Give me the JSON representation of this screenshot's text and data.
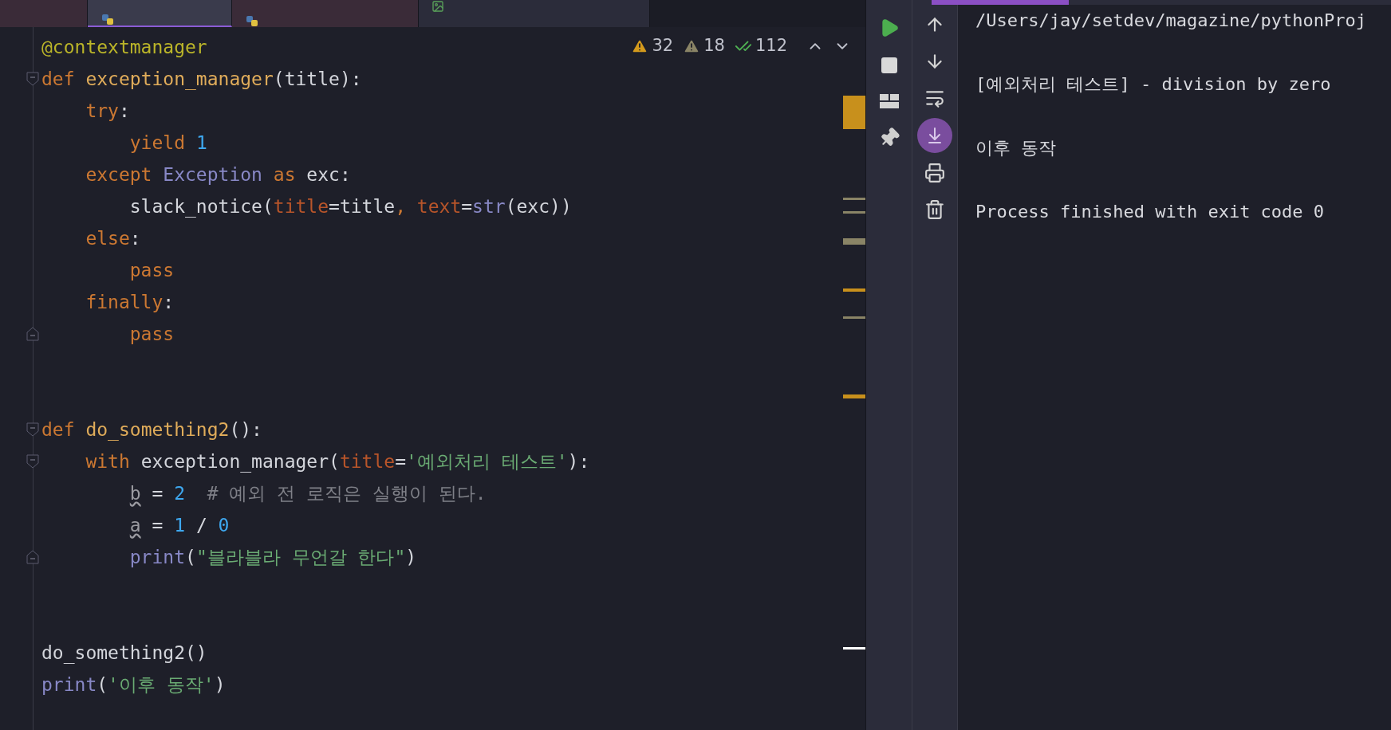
{
  "tabs": [
    {
      "kind": "none",
      "selected": false
    },
    {
      "kind": "python",
      "selected": true
    },
    {
      "kind": "python",
      "selected": false
    },
    {
      "kind": "image",
      "selected": false
    }
  ],
  "inspections": [
    {
      "kind": "warning",
      "count": "32"
    },
    {
      "kind": "weak_warning",
      "count": "18"
    },
    {
      "kind": "ok",
      "count": "112"
    }
  ],
  "code_lines": [
    {
      "kind": "code",
      "tokens": [
        {
          "kind": "decorator",
          "text": "@contextmanager"
        }
      ]
    },
    {
      "kind": "code",
      "fold_start": true,
      "tokens": [
        {
          "kind": "keyword",
          "text": "def "
        },
        {
          "kind": "function",
          "text": "exception_manager"
        },
        {
          "kind": "plain",
          "text": "(title):"
        }
      ]
    },
    {
      "kind": "code",
      "tokens": [
        {
          "kind": "keyword",
          "text": "    try"
        },
        {
          "kind": "plain",
          "text": ":"
        }
      ]
    },
    {
      "kind": "code",
      "tokens": [
        {
          "kind": "keyword",
          "text": "        yield "
        },
        {
          "kind": "number",
          "text": "1"
        }
      ]
    },
    {
      "kind": "code",
      "tokens": [
        {
          "kind": "keyword",
          "text": "    except "
        },
        {
          "kind": "builtin",
          "text": "Exception "
        },
        {
          "kind": "keyword",
          "text": "as "
        },
        {
          "kind": "plain",
          "text": "exc:"
        }
      ]
    },
    {
      "kind": "code",
      "tokens": [
        {
          "kind": "plain",
          "text": "        slack_notice("
        },
        {
          "kind": "param",
          "text": "title"
        },
        {
          "kind": "plain",
          "text": "=title"
        },
        {
          "kind": "keyword",
          "text": ", "
        },
        {
          "kind": "param",
          "text": "text"
        },
        {
          "kind": "plain",
          "text": "="
        },
        {
          "kind": "builtin",
          "text": "str"
        },
        {
          "kind": "plain",
          "text": "(exc))"
        }
      ]
    },
    {
      "kind": "code",
      "tokens": [
        {
          "kind": "keyword",
          "text": "    else"
        },
        {
          "kind": "plain",
          "text": ":"
        }
      ]
    },
    {
      "kind": "code",
      "tokens": [
        {
          "kind": "keyword",
          "text": "        pass"
        }
      ]
    },
    {
      "kind": "code",
      "tokens": [
        {
          "kind": "keyword",
          "text": "    finally"
        },
        {
          "kind": "plain",
          "text": ":"
        }
      ]
    },
    {
      "kind": "code",
      "fold_end": true,
      "tokens": [
        {
          "kind": "keyword",
          "text": "        pass"
        }
      ]
    },
    {
      "kind": "blank"
    },
    {
      "kind": "blank"
    },
    {
      "kind": "code",
      "fold_start": true,
      "tokens": [
        {
          "kind": "keyword",
          "text": "def "
        },
        {
          "kind": "function",
          "text": "do_something2"
        },
        {
          "kind": "plain",
          "text": "():"
        }
      ]
    },
    {
      "kind": "code",
      "fold_start": true,
      "tokens": [
        {
          "kind": "keyword",
          "text": "    with "
        },
        {
          "kind": "plain",
          "text": "exception_manager("
        },
        {
          "kind": "param",
          "text": "title"
        },
        {
          "kind": "plain",
          "text": "="
        },
        {
          "kind": "string",
          "text": "'예외처리 테스트'"
        },
        {
          "kind": "plain",
          "text": "):"
        }
      ]
    },
    {
      "kind": "code",
      "tokens": [
        {
          "kind": "unused",
          "text": "        b"
        },
        {
          "kind": "plain",
          "text": " = "
        },
        {
          "kind": "number",
          "text": "2"
        },
        {
          "kind": "comment",
          "text": "  # 예외 전 로직은 실행이 된다."
        }
      ]
    },
    {
      "kind": "code",
      "tokens": [
        {
          "kind": "unused",
          "text": "        a"
        },
        {
          "kind": "plain",
          "text": " = "
        },
        {
          "kind": "number",
          "text": "1"
        },
        {
          "kind": "plain",
          "text": " / "
        },
        {
          "kind": "number",
          "text": "0"
        }
      ]
    },
    {
      "kind": "code",
      "fold_end": true,
      "tokens": [
        {
          "kind": "builtin",
          "text": "        print"
        },
        {
          "kind": "plain",
          "text": "("
        },
        {
          "kind": "string",
          "text": "\"블라블라 무언갈 한다\""
        },
        {
          "kind": "plain",
          "text": ")"
        }
      ]
    },
    {
      "kind": "blank"
    },
    {
      "kind": "blank"
    },
    {
      "kind": "code",
      "tokens": [
        {
          "kind": "plain",
          "text": "do_something2()"
        }
      ]
    },
    {
      "kind": "code",
      "tokens": [
        {
          "kind": "builtin",
          "text": "print"
        },
        {
          "kind": "plain",
          "text": "("
        },
        {
          "kind": "string",
          "text": "'이후 동작'"
        },
        {
          "kind": "plain",
          "text": ")"
        }
      ]
    }
  ],
  "console": [
    "/Users/jay/setdev/magazine/pythonProj",
    "[예외처리 테스트] - division by zero",
    "이후 동작",
    "Process finished with exit code 0"
  ]
}
